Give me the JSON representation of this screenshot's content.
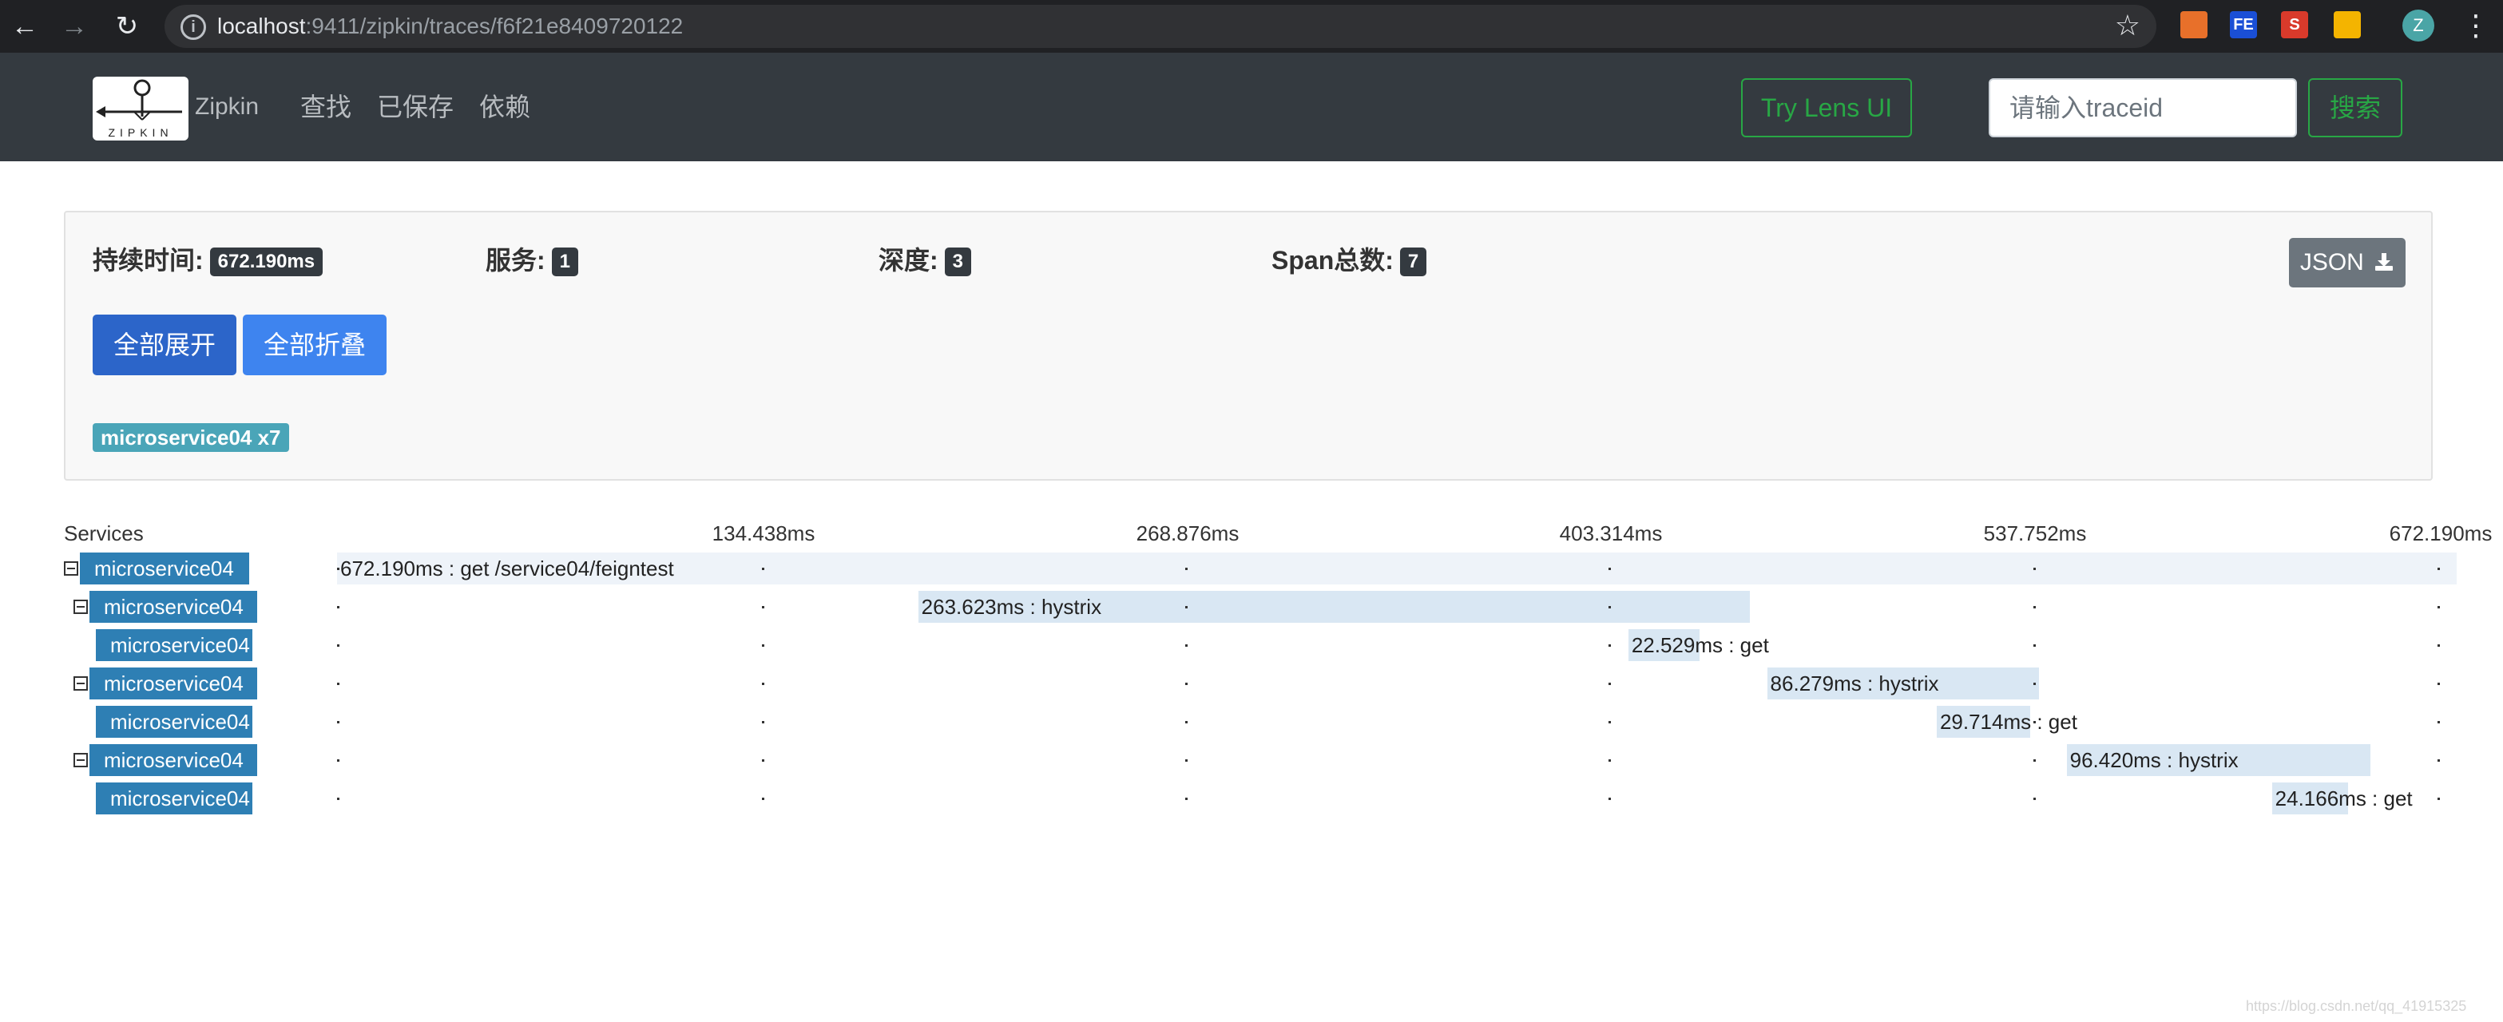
{
  "browser": {
    "url_host": "localhost",
    "url_rest": ":9411/zipkin/traces/f6f21e8409720122",
    "back_icon": "arrow-left-icon",
    "forward_icon": "arrow-right-icon",
    "reload_icon": "reload-icon",
    "star_icon": "star-icon",
    "extensions": [
      {
        "name": "fox-extension-icon",
        "label": "",
        "color": "#e8702a"
      },
      {
        "name": "fe-extension-icon",
        "label": "FE",
        "color": "#1a4fd6"
      },
      {
        "name": "s-extension-icon",
        "label": "S",
        "color": "#d93a2b"
      },
      {
        "name": "colorful-extension-icon",
        "label": "",
        "color": "#f4b400"
      }
    ],
    "avatar_letter": "Z"
  },
  "nav": {
    "logo_text": "ZIPKIN",
    "brand": "Zipkin",
    "links": [
      "查找",
      "已保存",
      "依赖"
    ],
    "lens_button": "Try Lens UI",
    "search_placeholder": "请输入traceid",
    "search_button": "搜索"
  },
  "summary": {
    "duration_label": "持续时间:",
    "duration_value": "672.190ms",
    "services_label": "服务:",
    "services_value": "1",
    "depth_label": "深度:",
    "depth_value": "3",
    "spans_label": "Span总数:",
    "spans_value": "7",
    "json_button": "JSON",
    "expand_all": "全部展开",
    "collapse_all": "全部折叠",
    "service_tag": "microservice04 x7"
  },
  "timeline": {
    "services_header": "Services",
    "ticks": [
      "134.438ms",
      "268.876ms",
      "403.314ms",
      "537.752ms",
      "672.190ms"
    ],
    "total_ms": 672.19,
    "spans": [
      {
        "service": "microservice04",
        "depth": 0,
        "collapsible": true,
        "start_ms": 0,
        "duration_ms": 672.19,
        "label": "672.190ms : get /service04/feigntest"
      },
      {
        "service": "microservice04",
        "depth": 1,
        "collapsible": true,
        "start_ms": 184.3,
        "duration_ms": 263.623,
        "label": "263.623ms : hystrix"
      },
      {
        "service": "microservice04",
        "depth": 2,
        "collapsible": false,
        "start_ms": 409.5,
        "duration_ms": 22.529,
        "label": "22.529ms : get"
      },
      {
        "service": "microservice04",
        "depth": 1,
        "collapsible": true,
        "start_ms": 453.5,
        "duration_ms": 86.279,
        "label": "86.279ms : hystrix"
      },
      {
        "service": "microservice04",
        "depth": 2,
        "collapsible": false,
        "start_ms": 507.3,
        "duration_ms": 29.714,
        "label": "29.714ms : get"
      },
      {
        "service": "microservice04",
        "depth": 1,
        "collapsible": true,
        "start_ms": 548.5,
        "duration_ms": 96.42,
        "label": "96.420ms : hystrix"
      },
      {
        "service": "microservice04",
        "depth": 2,
        "collapsible": false,
        "start_ms": 613.6,
        "duration_ms": 24.166,
        "label": "24.166ms : get"
      }
    ]
  },
  "watermark": "https://blog.csdn.net/qq_41915325"
}
